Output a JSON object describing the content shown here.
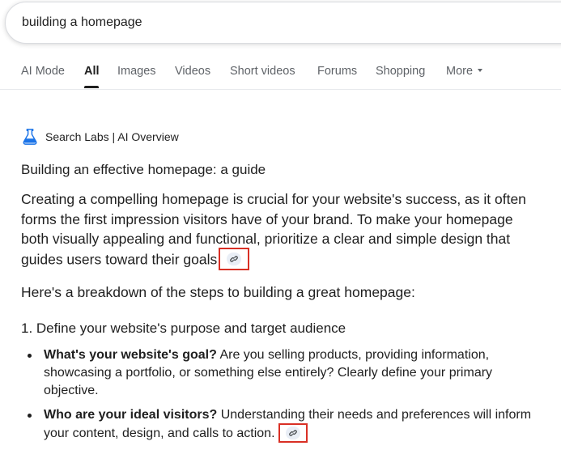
{
  "search": {
    "query": "building a homepage"
  },
  "tabs": [
    {
      "label": "AI Mode"
    },
    {
      "label": "All"
    },
    {
      "label": "Images"
    },
    {
      "label": "Videos"
    },
    {
      "label": "Short videos"
    },
    {
      "label": "Forums"
    },
    {
      "label": "Shopping"
    },
    {
      "label": "More"
    }
  ],
  "active_tab": "All",
  "overview": {
    "badge": "Search Labs | AI Overview",
    "title": "Building an effective homepage: a guide",
    "intro": "Creating a compelling homepage is crucial for your website's success, as it often forms the first impression visitors have of your brand. To make your homepage both visually appealing and functional, prioritize a clear and simple design that guides users toward their goals",
    "breakdown": "Here's a breakdown of the steps to building a great homepage:",
    "step1": {
      "heading": "1. Define your website's purpose and target audience",
      "bullets": [
        {
          "bold": "What's your website's goal?",
          "text": " Are you selling products, providing information, showcasing a portfolio, or something else entirely? Clearly define your primary objective."
        },
        {
          "bold": "Who are your ideal visitors?",
          "text": " Understanding their needs and preferences will inform your content, design, and calls to action."
        }
      ]
    }
  },
  "icons": {
    "labs": "flask-icon",
    "citation": "link-icon"
  },
  "colors": {
    "accent_blue": "#1a73e8",
    "highlight_red": "#d93025"
  }
}
